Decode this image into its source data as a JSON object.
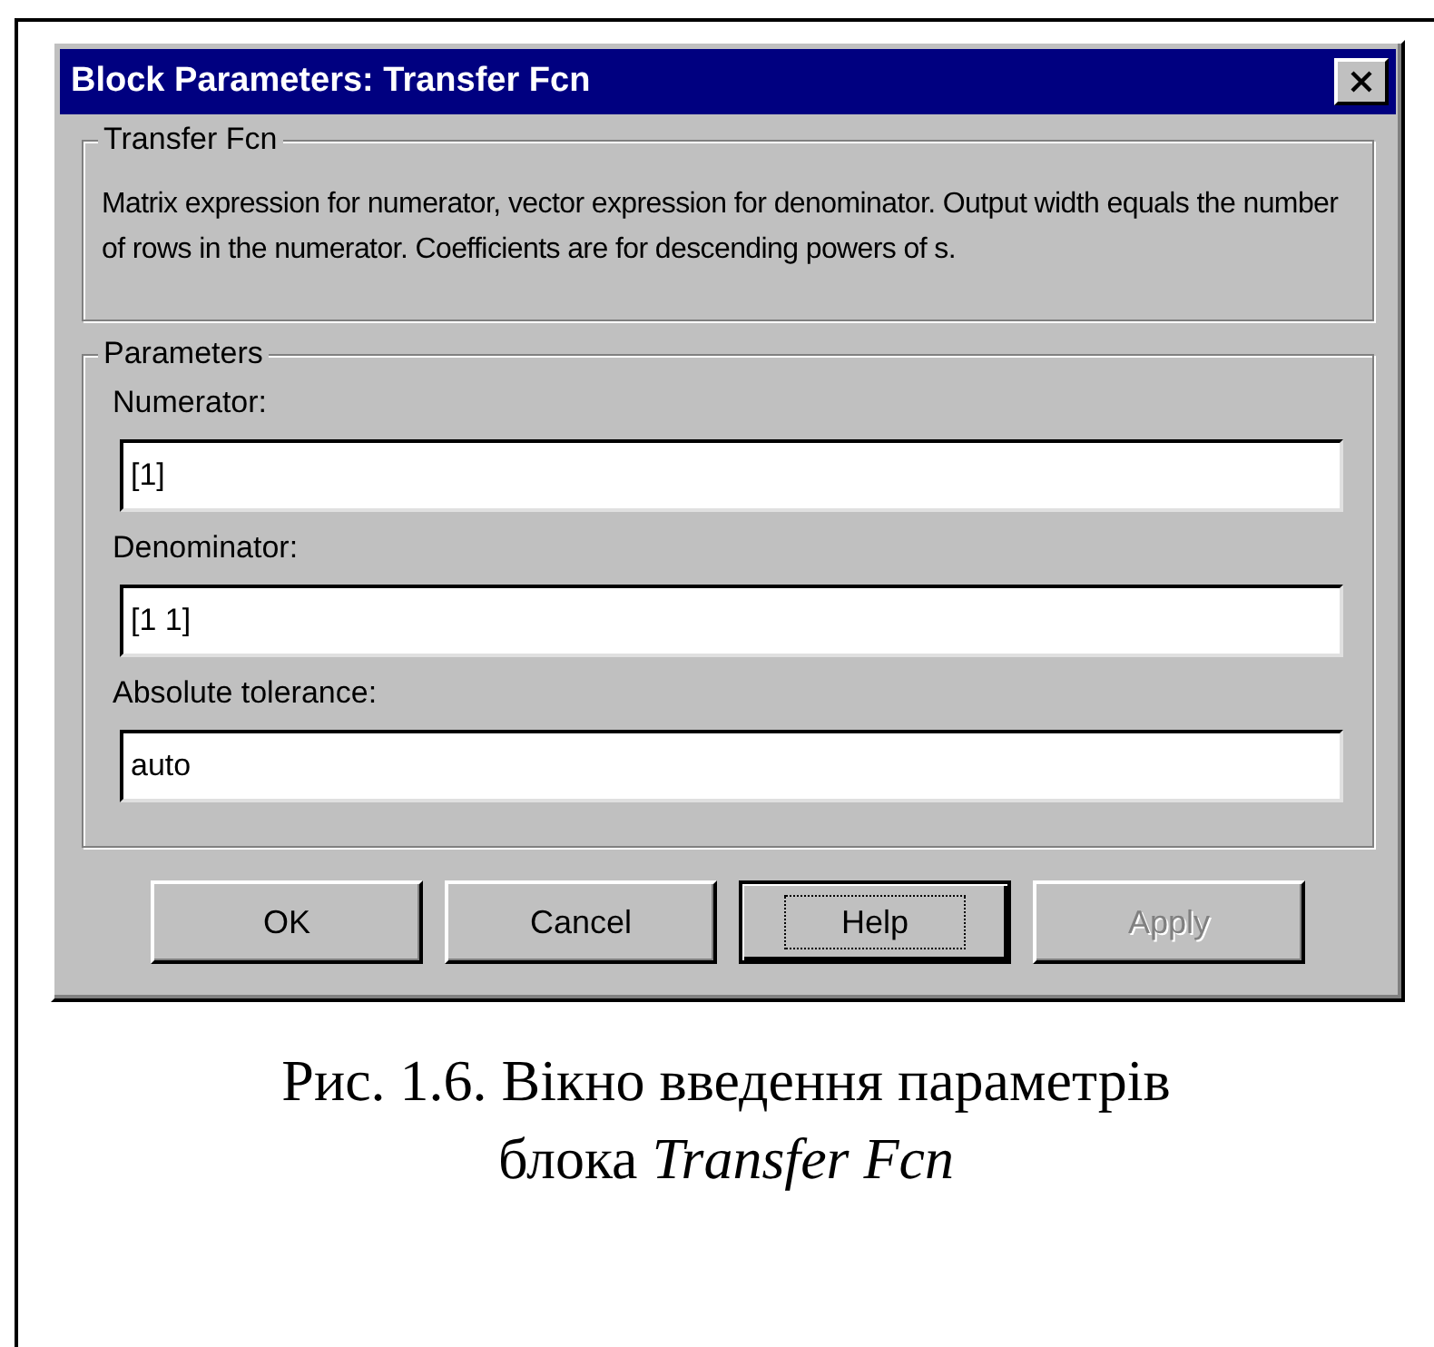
{
  "window": {
    "title": "Block Parameters: Transfer Fcn"
  },
  "description_group": {
    "title": "Transfer Fcn",
    "text": "Matrix expression for numerator, vector expression for denominator. Output width equals the number of rows in the numerator.  Coefficients are for descending powers of s."
  },
  "parameters_group": {
    "title": "Parameters",
    "fields": [
      {
        "label": "Numerator:",
        "value": "[1]"
      },
      {
        "label": "Denominator:",
        "value": "[1 1]"
      },
      {
        "label": "Absolute tolerance:",
        "value": "auto"
      }
    ]
  },
  "buttons": [
    {
      "label": "OK",
      "focused": false,
      "disabled": false
    },
    {
      "label": "Cancel",
      "focused": false,
      "disabled": false
    },
    {
      "label": "Help",
      "focused": true,
      "disabled": false
    },
    {
      "label": "Apply",
      "focused": false,
      "disabled": true
    }
  ],
  "caption": "Рис. 1.6. Вікно введення параметрів блока *Transfer Fcn*"
}
